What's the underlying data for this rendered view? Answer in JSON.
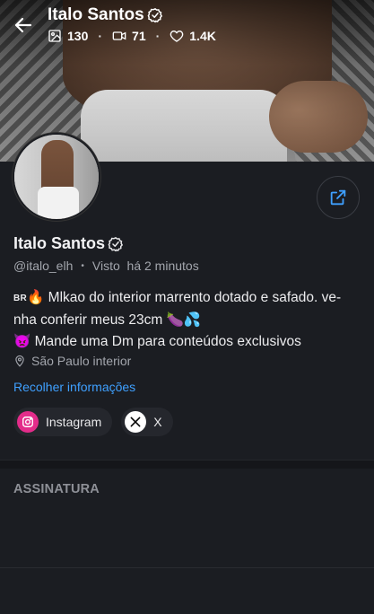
{
  "header": {
    "name": "Italo Santos",
    "stats": {
      "photos": "130",
      "videos": "71",
      "likes": "1.4K"
    }
  },
  "profile": {
    "name": "Italo Santos",
    "handle": "@italo_elh",
    "last_seen": "Visto  há 2 minutos",
    "bio_line1_prefix": "BR",
    "bio_line1": "🔥 Mlkao do interior marrento dotado e safado. ve-",
    "bio_line2": "nha conferir meus 23cm 🍆💦",
    "bio_line3": "👿 Mande uma Dm para conteúdos exclusivos",
    "location": "São Paulo interior",
    "collapse_label": "Recolher informações"
  },
  "socials": [
    {
      "label": "Instagram",
      "icon": "instagram-icon"
    },
    {
      "label": "X",
      "icon": "x-icon"
    }
  ],
  "sections": {
    "subscription_title": "ASSINATURA"
  },
  "colors": {
    "accent": "#3fa0ff",
    "background": "#1b1d22",
    "instagram": "#e32c8a"
  }
}
